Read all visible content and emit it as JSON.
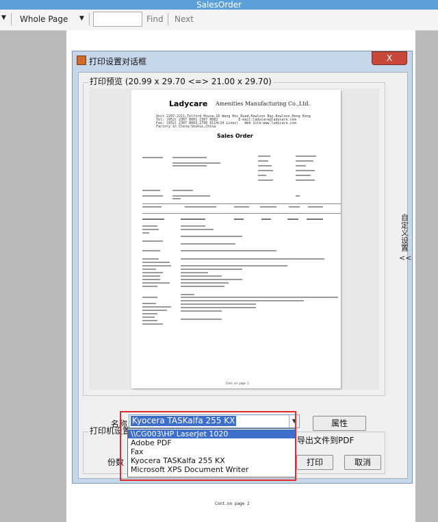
{
  "window": {
    "title": "SalesOrder"
  },
  "toolbar": {
    "zoom_value": "Whole Page",
    "find_value": "",
    "find_label": "Find",
    "next_label": "Next"
  },
  "background_page": {
    "footer": "Cont.on page 2"
  },
  "dialog": {
    "title": "打印设置对话框",
    "close_label": "X",
    "preview_label": "打印预览 (20.99 x 29.70 <=> 21.00 x 29.70)",
    "side_tab_label": "自定义设置",
    "side_tab_arrow": "<<",
    "print_group_label": "打印机设置",
    "name_label": "名称",
    "copies_label": "份数",
    "printer_selected": "Kyocera TASKalfa 255 KX",
    "printer_options": [
      "\\\\CG003\\HP LaserJet 1020",
      "Adobe PDF",
      "Fax",
      "Kyocera TASKalfa 255 KX",
      "Microsoft XPS Document Writer"
    ],
    "properties_label": "属性",
    "export_pdf_label": "导出文件到PDF",
    "print_label": "打印",
    "cancel_label": "取消"
  },
  "document": {
    "logo": "Ladycare",
    "company": "Amenities Manufacturing Co.,Ltd.",
    "address": "Unit 2207-2211,Telford House,16 Wang Hoi Road,Kowloon Bay,Kowloon,Hong Kong\nTel: (852) 2307 8001 2307 8082          E-mail:ladycare@ladycare.com\nFax: (852) 2307 8003,2790 9114(24 Lines)   Web Site:www.ladycare.com\nFactory in China:Shuhui,China",
    "title": "Sales Order",
    "footer": "Cont.on page 2"
  }
}
